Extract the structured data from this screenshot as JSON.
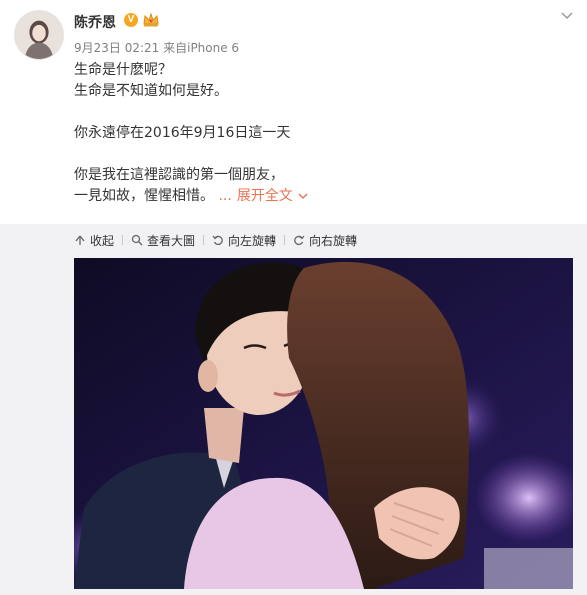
{
  "user": {
    "name": "陈乔恩",
    "verified_mark": "V",
    "meta": "9月23日 02:21 来自iPhone 6"
  },
  "post": {
    "lines": [
      "生命是什麽呢？",
      "生命是不知道如何是好。",
      "",
      "你永遠停在2016年9月16日這一天",
      "",
      "你是我在這裡認識的第一個朋友，",
      "一見如故，惺惺相惜。"
    ],
    "ellipsis": "...",
    "expand_label": "展开全文"
  },
  "toolbar": {
    "collapse": "收起",
    "view_large": "查看大圖",
    "rotate_left": "向左旋轉",
    "rotate_right": "向右旋轉"
  },
  "icons": [
    "chevron-down-icon",
    "crown-icon",
    "collapse-icon",
    "magnifier-icon",
    "rotate-left-icon",
    "rotate-right-icon"
  ],
  "colors": {
    "accent": "#eb7350",
    "verified": "#f6a623",
    "media_bg": "#f2f2f5",
    "meta_text": "#808080"
  }
}
